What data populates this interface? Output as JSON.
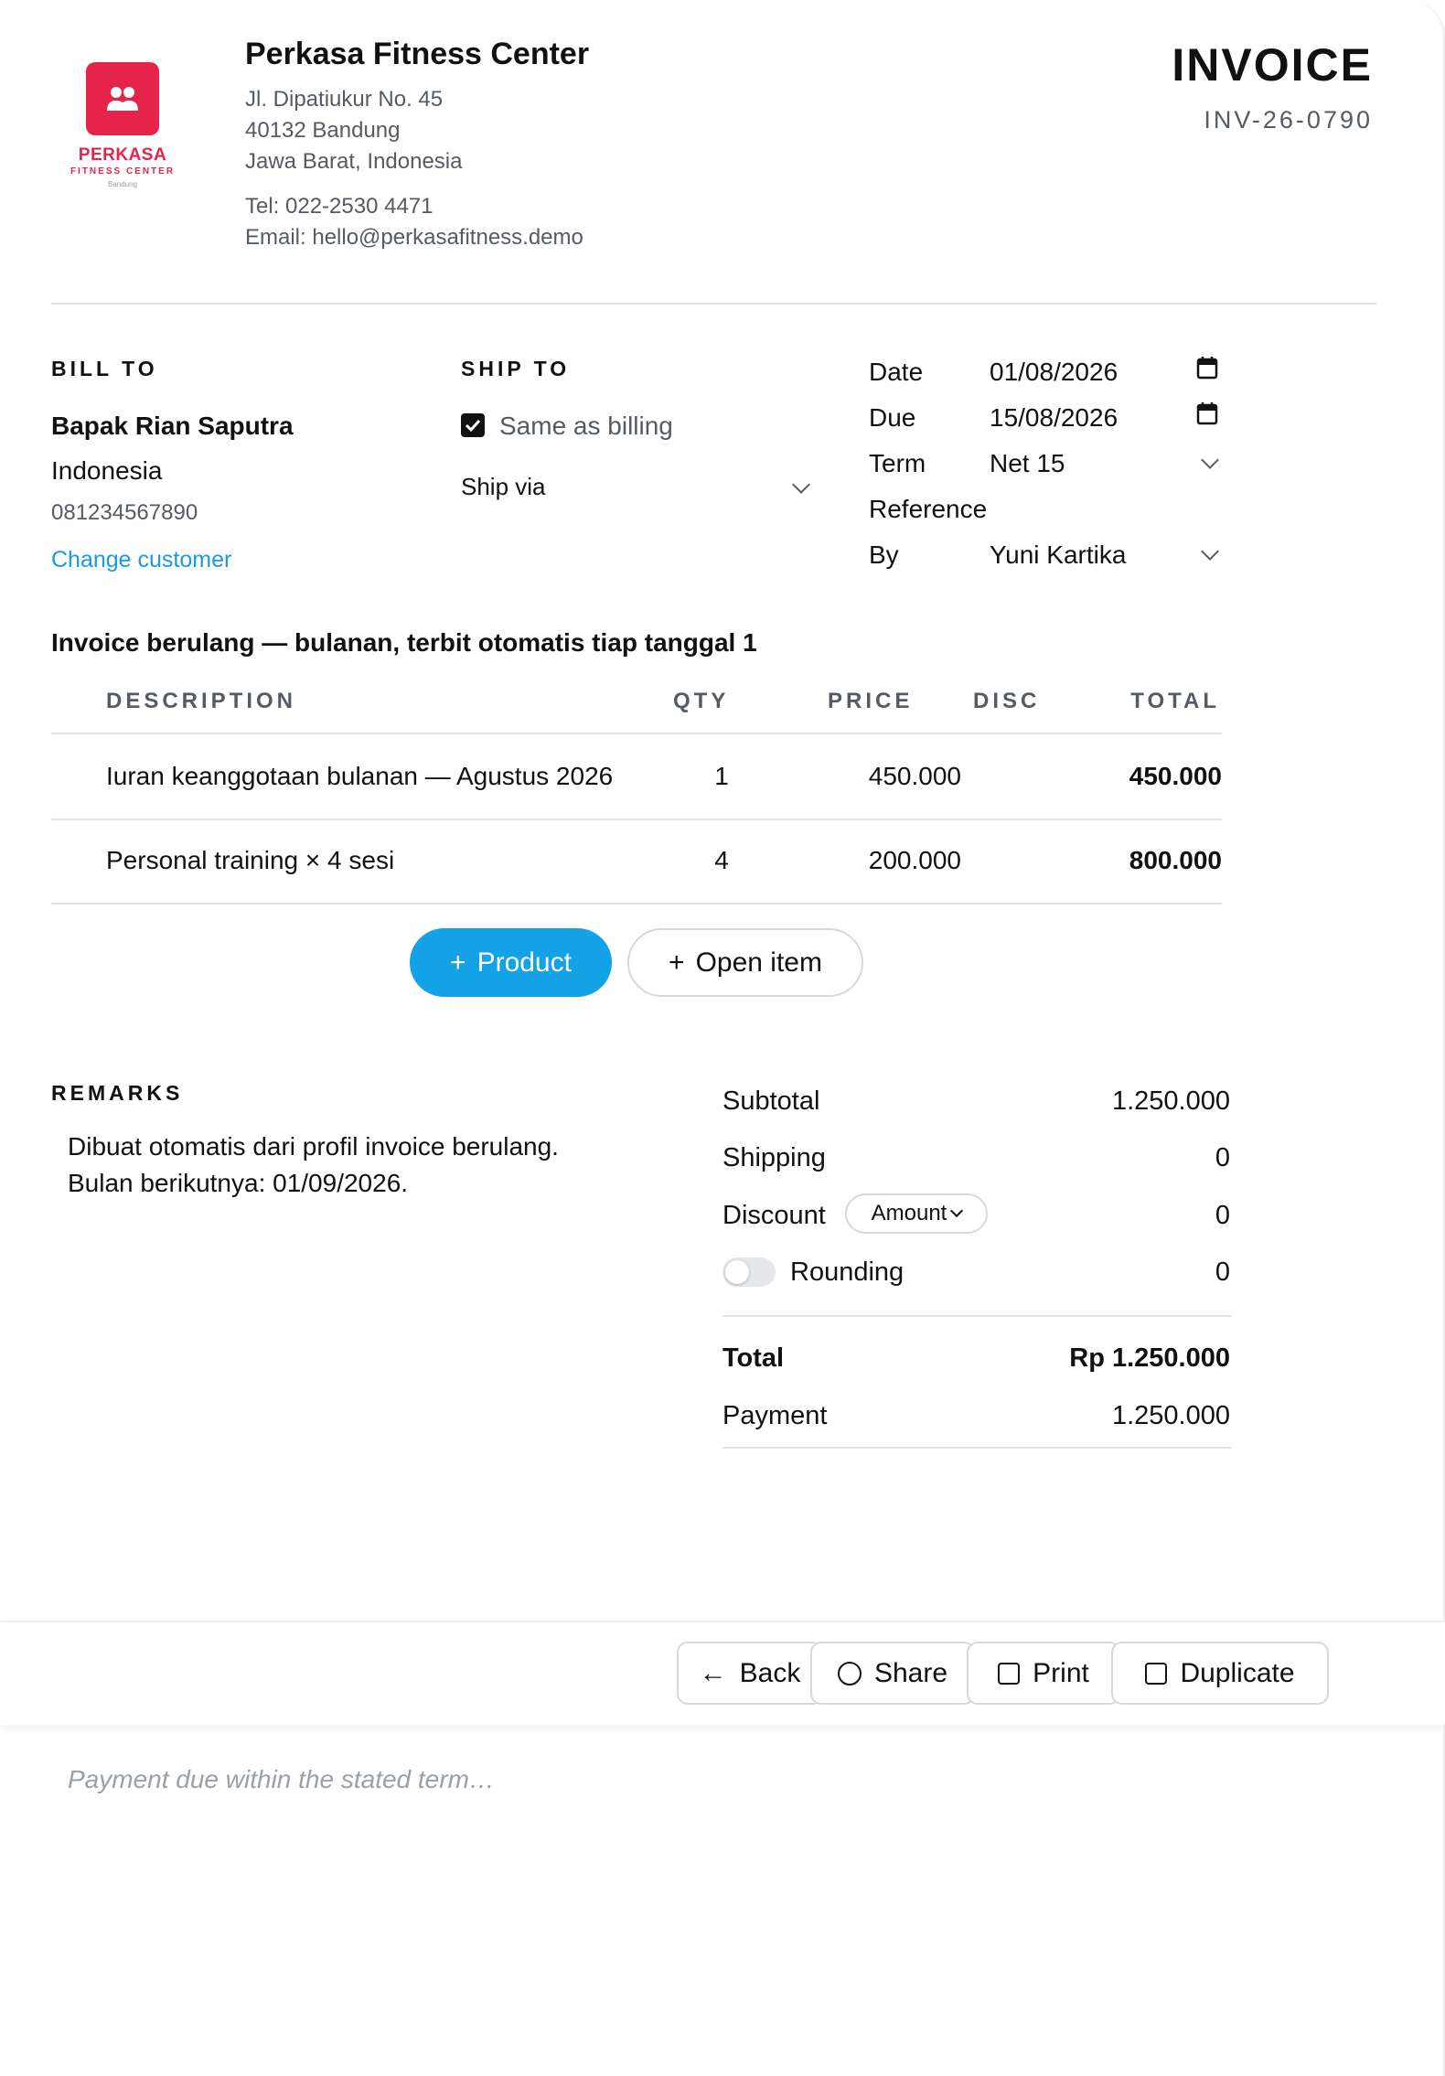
{
  "company": {
    "logo_name": "PERKASA",
    "logo_tagline": "FITNESS CENTER",
    "logo_city": "Bandung",
    "name": "Perkasa Fitness Center",
    "address_line1": "Jl. Dipatiukur No. 45",
    "address_line2": "40132 Bandung",
    "address_line3": "Jawa Barat, Indonesia",
    "tel": "Tel: 022-2530 4471",
    "email": "Email: hello@perkasafitness.demo"
  },
  "invoice": {
    "title": "INVOICE",
    "number": "INV-26-0790"
  },
  "bill_to": {
    "label": "BILL TO",
    "name": "Bapak Rian Saputra",
    "country": "Indonesia",
    "phone": "081234567890",
    "change_link": "Change customer"
  },
  "ship_to": {
    "label": "SHIP TO",
    "same_as_billing": "Same as billing",
    "same_as_billing_checked": true,
    "ship_via": "Ship via"
  },
  "meta": {
    "date_label": "Date",
    "date_value": "01/08/2026",
    "due_label": "Due",
    "due_value": "15/08/2026",
    "term_label": "Term",
    "term_value": "Net 15",
    "reference_label": "Reference",
    "reference_value": "",
    "by_label": "By",
    "by_value": "Yuni Kartika"
  },
  "recurring_note": "Invoice berulang — bulanan, terbit otomatis tiap tanggal 1",
  "table": {
    "headers": {
      "description": "DESCRIPTION",
      "qty": "QTY",
      "price": "PRICE",
      "disc": "DISC",
      "total": "TOTAL"
    },
    "rows": [
      {
        "description": "Iuran keanggotaan bulanan — Agustus 2026",
        "qty": "1",
        "price": "450.000",
        "disc": "",
        "total": "450.000"
      },
      {
        "description": "Personal training × 4 sesi",
        "qty": "4",
        "price": "200.000",
        "disc": "",
        "total": "800.000"
      }
    ]
  },
  "add_buttons": {
    "product": "Product",
    "open_item": "Open item"
  },
  "remarks": {
    "label": "REMARKS",
    "line1": "Dibuat otomatis dari profil invoice berulang.",
    "line2": "Bulan berikutnya: 01/09/2026."
  },
  "summary": {
    "subtotal_label": "Subtotal",
    "subtotal_value": "1.250.000",
    "shipping_label": "Shipping",
    "shipping_value": "0",
    "discount_label": "Discount",
    "discount_mode": "Amount",
    "discount_value": "0",
    "rounding_label": "Rounding",
    "rounding_on": false,
    "rounding_value": "0",
    "total_label": "Total",
    "total_value": "Rp 1.250.000",
    "payment_label": "Payment",
    "payment_value": "1.250.000"
  },
  "footer": {
    "back": "Back",
    "share": "Share",
    "print": "Print",
    "duplicate": "Duplicate",
    "note_placeholder": "Payment due within the stated term…"
  },
  "colors": {
    "brand": "#e6244a",
    "accent": "#13a2e6",
    "link": "#1a9be0"
  }
}
